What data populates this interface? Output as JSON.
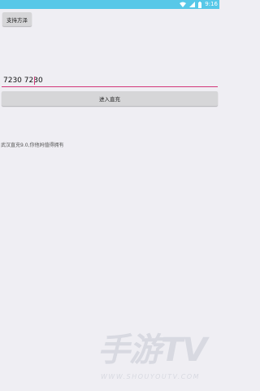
{
  "status_bar": {
    "time": "9:16",
    "icons": [
      "wifi-icon",
      "signal-icon",
      "battery-icon"
    ],
    "color": "#57c8e8"
  },
  "support_button": {
    "label": "支持方泽"
  },
  "input": {
    "value": "7230 7230"
  },
  "enter_button": {
    "label": "进入直充"
  },
  "info": {
    "text": "武汉直充9.0,你他妈值得拥有"
  },
  "watermark": {
    "main": "手游TV",
    "sub": "WWW.SHOUYOUTV.COM"
  }
}
